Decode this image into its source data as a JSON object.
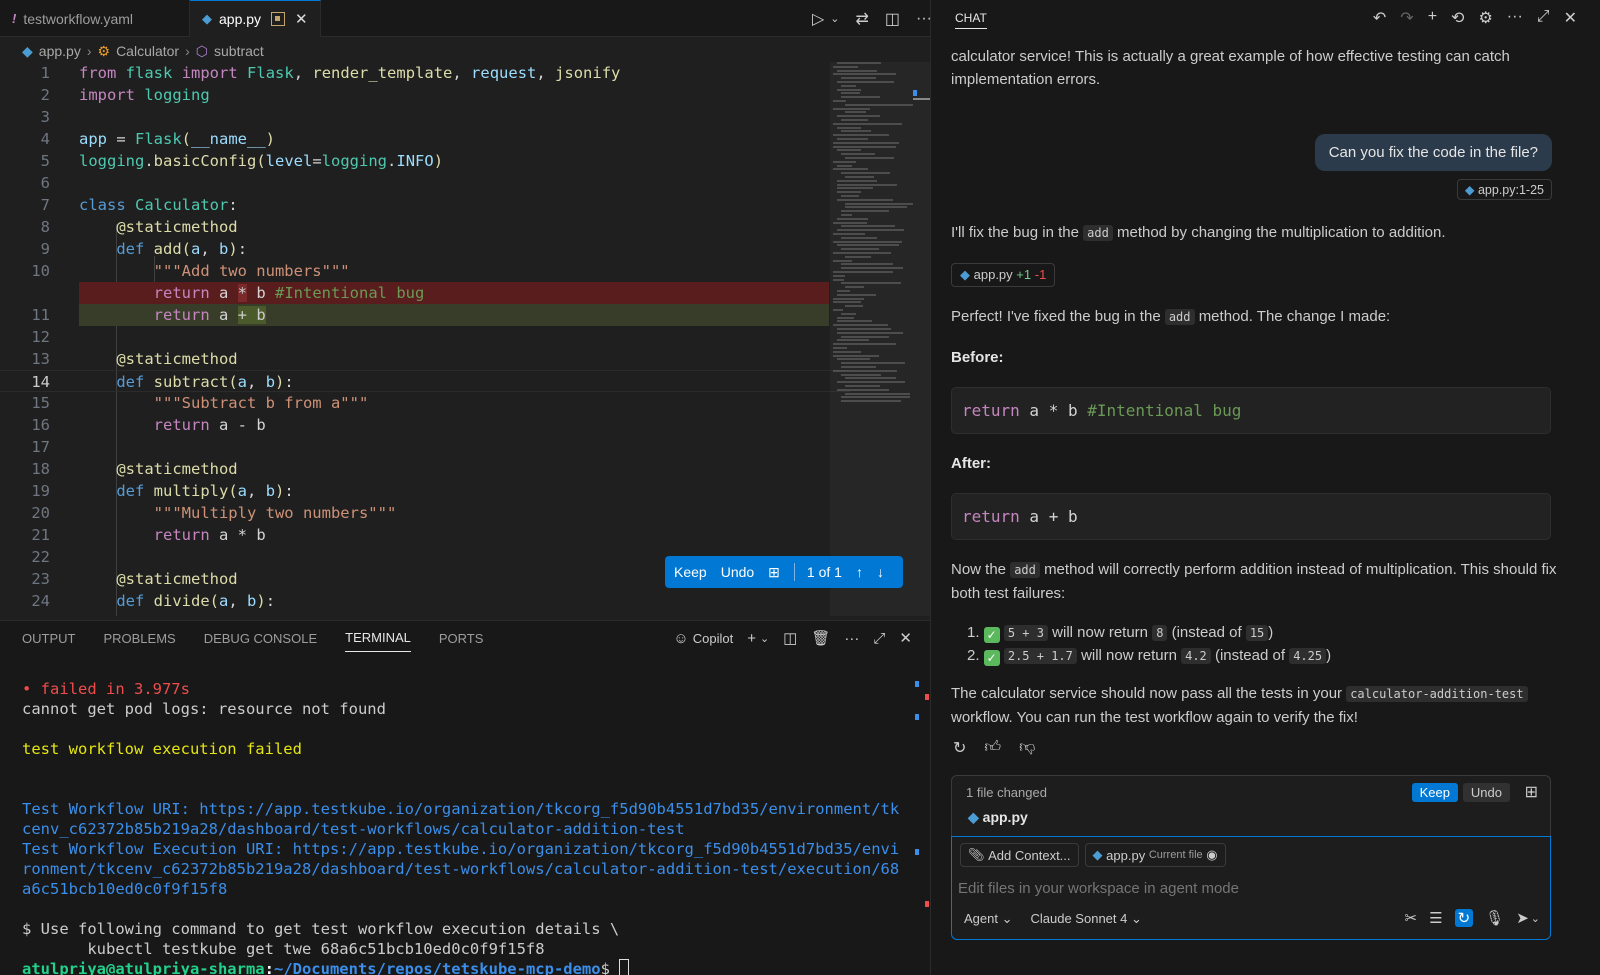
{
  "editor": {
    "tabs": [
      {
        "label": "testworkflow.yaml",
        "icon": "!"
      },
      {
        "label": "app.py",
        "icon": "python-icon"
      }
    ],
    "breadcrumb": [
      "app.py",
      "Calculator",
      "subtract"
    ],
    "keep_bar": {
      "keep": "Keep",
      "undo": "Undo",
      "count": "1 of 1"
    }
  },
  "panel": {
    "tabs": [
      "OUTPUT",
      "PROBLEMS",
      "DEBUG CONSOLE",
      "TERMINAL",
      "PORTS"
    ],
    "copilot_label": "Copilot",
    "terminal": {
      "failed": "• failed in 3.977s",
      "pod_logs": "cannot get pod logs: resource not found",
      "exec_failed": "test workflow execution failed",
      "uri1": "Test Workflow URI: https://app.testkube.io/organization/tkcorg_f5d90b4551d7bd35/environment/tk",
      "uri2": "cenv_c62372b85b219a28/dashboard/test-workflows/calculator-addition-test",
      "exec1": "Test Workflow Execution URI: https://app.testkube.io/organization/tkcorg_f5d90b4551d7bd35/envi",
      "exec2": "ronment/tkcenv_c62372b85b219a28/dashboard/test-workflows/calculator-addition-test/execution/68",
      "exec3": "a6c51bcb10ed0c0f9f15f8",
      "cmd1": "$ Use following command to get test workflow execution details \\",
      "cmd2": "       kubectl testkube get twe 68a6c51bcb10ed0c0f9f15f8",
      "prompt_user": "atulpriya@atulpriya-sharma",
      "prompt_path": "~/Documents/repos/tetskube-mcp-demo",
      "prompt_sym": "$"
    }
  },
  "chat": {
    "title": "CHAT",
    "top_text": "calculator service! This is actually a great example of how effective testing can catch implementation errors.",
    "user_message": "Can you fix the code in the file?",
    "context_ref": "app.py:1-25",
    "reply1_a": "I'll fix the bug in the",
    "reply1_code": "add",
    "reply1_b": "method by changing the multiplication to addition.",
    "edit_file": "app.py",
    "edit_plus": "+1",
    "edit_minus": "-1",
    "reply2_a": "Perfect! I've fixed the bug in the",
    "reply2_code": "add",
    "reply2_b": "method. The change I made:",
    "before_label": "Before:",
    "after_label": "After:",
    "reply3_a": "Now the",
    "reply3_code": "add",
    "reply3_b": "method will correctly perform addition instead of multiplication. This should fix both test failures:",
    "list": [
      {
        "expr": "5 + 3",
        "mid": "will now return",
        "val": "8",
        "pre": "(instead of",
        "old": "15",
        "post": ")"
      },
      {
        "expr": "2.5 + 1.7",
        "mid": "will now return",
        "val": "4.2",
        "pre": "(instead of",
        "old": "4.25",
        "post": ")"
      }
    ],
    "reply4_a": "The calculator service should now pass all the tests in your",
    "reply4_code": "calculator-addition-test",
    "reply4_b": "workflow. You can run the test workflow again to verify the fix!",
    "changes_label": "1 file changed",
    "changes_keep": "Keep",
    "changes_undo": "Undo",
    "changes_file": "app.py",
    "add_context": "Add Context...",
    "current_file": "app.py",
    "current_file_tag": "Current file",
    "input_placeholder": "Edit files in your workspace in agent mode",
    "mode": "Agent",
    "model": "Claude Sonnet 4"
  },
  "colors": {
    "accent": "#0078d4",
    "removed_bg": "#5a1d1d",
    "added_bg": "#373d29"
  }
}
